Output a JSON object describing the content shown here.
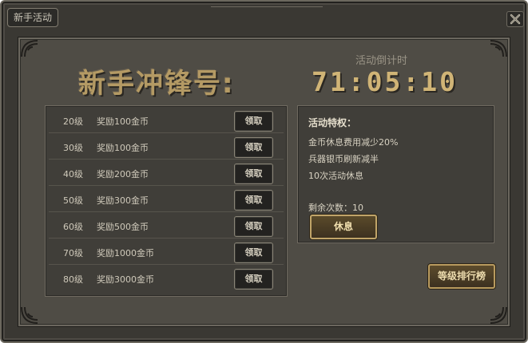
{
  "window": {
    "title": "新手活动",
    "close_icon": "close-icon"
  },
  "header": {
    "main_title": "新手冲锋号:",
    "countdown_label": "活动倒计时",
    "countdown_value": "71:05:10"
  },
  "rewards": [
    {
      "level": "20级",
      "reward": "奖励100金币",
      "button": "领取"
    },
    {
      "level": "30级",
      "reward": "奖励100金币",
      "button": "领取"
    },
    {
      "level": "40级",
      "reward": "奖励200金币",
      "button": "领取"
    },
    {
      "level": "50级",
      "reward": "奖励300金币",
      "button": "领取"
    },
    {
      "level": "60级",
      "reward": "奖励500金币",
      "button": "领取"
    },
    {
      "level": "70级",
      "reward": "奖励1000金币",
      "button": "领取"
    },
    {
      "level": "80级",
      "reward": "奖励3000金币",
      "button": "领取"
    }
  ],
  "privileges": {
    "title": "活动特权：",
    "lines": [
      "金币休息费用减少20%",
      "兵器银币刷新减半",
      "10次活动休息"
    ],
    "remaining": "剩余次数：10",
    "rest_button": "休息"
  },
  "ranking_button": "等级排行榜",
  "colors": {
    "background": "#3a3833",
    "panel": "#4f4c45",
    "accent_gold": "#d0b476",
    "title_gold": "#b49a64"
  }
}
